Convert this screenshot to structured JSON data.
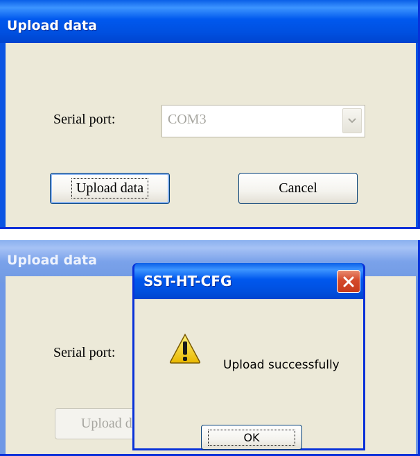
{
  "dialog_before": {
    "title": "Upload data",
    "serial_port_label": "Serial port:",
    "serial_port_value": "COM3",
    "upload_button_label": "Upload data",
    "cancel_button_label": "Cancel"
  },
  "dialog_after": {
    "title": "Upload data",
    "serial_port_label": "Serial port:",
    "upload_button_label": "Upload data"
  },
  "message_box": {
    "title": "SST-HT-CFG",
    "icon": "warning-icon",
    "message": "Upload successfully",
    "ok_label": "OK"
  },
  "colors": {
    "titlebar_blue": "#0054e3",
    "dialog_face": "#ece9d8",
    "close_red": "#d4492a",
    "disabled_text": "#a7a6a0"
  }
}
